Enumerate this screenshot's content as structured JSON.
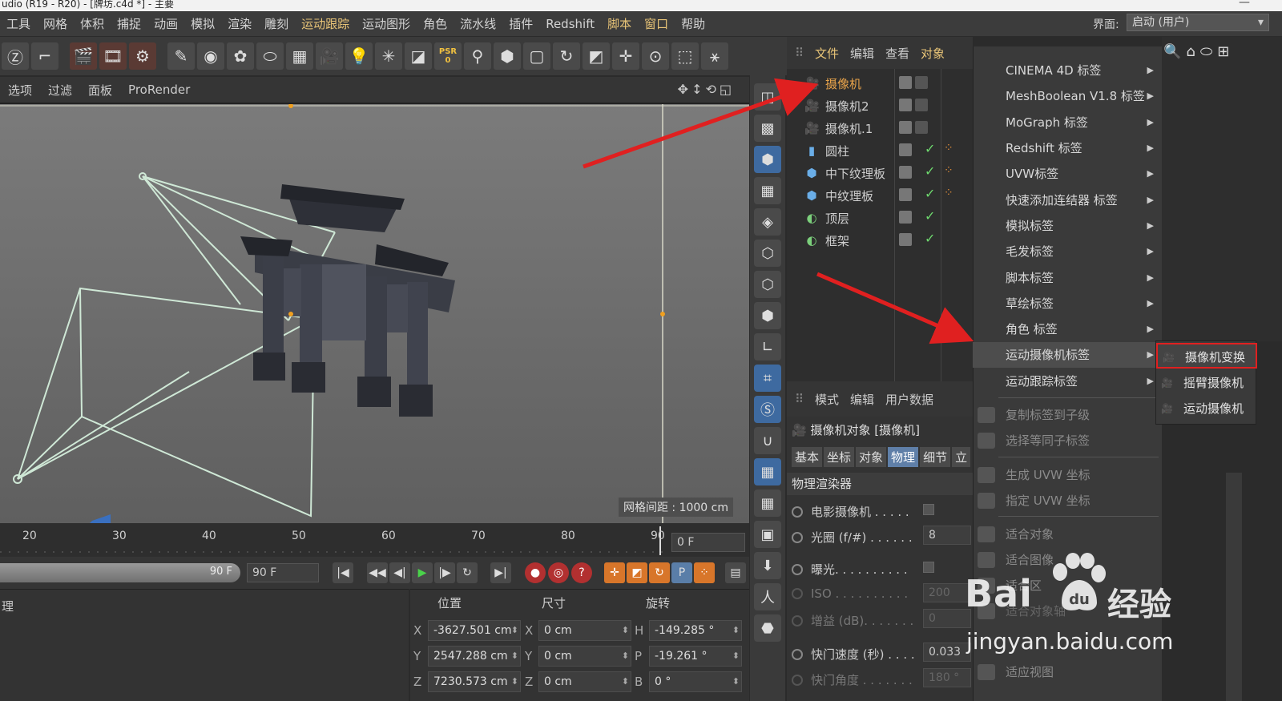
{
  "window": {
    "title": "udio (R19 - R20) - [牌坊.c4d *] - 主要",
    "controls": "—"
  },
  "menubar": {
    "items": [
      "工具",
      "网格",
      "体积",
      "捕捉",
      "动画",
      "模拟",
      "渲染",
      "雕刻",
      "运动跟踪",
      "运动图形",
      "角色",
      "流水线",
      "插件",
      "Redshift",
      "脚本",
      "窗口",
      "帮助"
    ],
    "layout_label": "界面:",
    "layout_value": "启动 (用户)"
  },
  "toolbar": {
    "psr_label": "PSR",
    "psr_value": "0"
  },
  "viewport": {
    "menu": [
      "选项",
      "过滤",
      "面板",
      "ProRender"
    ],
    "grid_label": "网格间距 : 1000 cm"
  },
  "timeline": {
    "ticks": [
      "20",
      "30",
      "40",
      "50",
      "60",
      "70",
      "80",
      "90"
    ],
    "current_frame": "0 F",
    "range_end": "90 F",
    "end_field": "90 F"
  },
  "materials": {
    "label": "理"
  },
  "coordinates": {
    "headers": {
      "position": "位置",
      "size": "尺寸",
      "rotation": "旋转"
    },
    "rows": [
      {
        "axis1": "X",
        "pos": "-3627.501 cm",
        "axis2": "X",
        "size": "0 cm",
        "axis3": "H",
        "rot": "-149.285 °"
      },
      {
        "axis1": "Y",
        "pos": "2547.288 cm",
        "axis2": "Y",
        "size": "0 cm",
        "axis3": "P",
        "rot": "-19.261 °"
      },
      {
        "axis1": "Z",
        "pos": "7230.573 cm",
        "axis2": "Z",
        "size": "0 cm",
        "axis3": "B",
        "rot": "0 °"
      }
    ]
  },
  "object_manager": {
    "menu": [
      "文件",
      "编辑",
      "查看",
      "对象"
    ],
    "objects": [
      {
        "name": "摄像机",
        "icon": "camera-icon"
      },
      {
        "name": "摄像机2",
        "icon": "camera-icon"
      },
      {
        "name": "摄像机.1",
        "icon": "camera-icon"
      },
      {
        "name": "圆柱",
        "icon": "cylinder-icon"
      },
      {
        "name": "中下纹理板",
        "icon": "cube-icon"
      },
      {
        "name": "中纹理板",
        "icon": "cube-icon"
      },
      {
        "name": "顶层",
        "icon": "sphere-icon"
      },
      {
        "name": "框架",
        "icon": "sphere-icon"
      }
    ]
  },
  "attribute_manager": {
    "menu": [
      "模式",
      "编辑",
      "用户数据"
    ],
    "title": "摄像机对象 [摄像机]",
    "tabs": [
      "基本",
      "坐标",
      "对象",
      "物理",
      "细节",
      "立"
    ],
    "section": "物理渲染器",
    "rows": [
      {
        "label": "电影摄像机 . . . . .",
        "value": ""
      },
      {
        "label": "光圈 (f/#) . . . . . .",
        "value": "8"
      },
      {
        "label": "曝光. . . . . . . . . .",
        "value": ""
      },
      {
        "label": "ISO . . . . . . . . . .",
        "value": "200"
      },
      {
        "label": "增益 (dB). . . . . . .",
        "value": "0"
      },
      {
        "label": "快门速度 (秒) . . . .",
        "value": "0.033"
      },
      {
        "label": "快门角度 . . . . . . .",
        "value": "180 °"
      }
    ]
  },
  "context_menu": {
    "items": [
      "CINEMA 4D 标签",
      "MeshBoolean V1.8 标签",
      "MoGraph 标签",
      "Redshift 标签",
      "UVW标签",
      "快速添加连结器 标签",
      "模拟标签",
      "毛发标签",
      "脚本标签",
      "草绘标签",
      "角色 标签",
      "运动摄像机标签",
      "运动跟踪标签"
    ],
    "actions": [
      "复制标签到子级",
      "选择等同子标签",
      "生成 UVW 坐标",
      "指定 UVW 坐标",
      "适合对象",
      "适合图像",
      "适合区",
      "适合对象轴",
      "适应视图"
    ]
  },
  "submenu": {
    "items": [
      "摄像机变换",
      "摇臂摄像机",
      "运动摄像机"
    ]
  },
  "watermark": {
    "brand": "Bai",
    "brand_cn": "经验",
    "url": "jingyan.baidu.com"
  },
  "colors": {
    "highlight": "#e8c477",
    "selection_red": "#e02020",
    "arrow_red": "#e02020"
  }
}
